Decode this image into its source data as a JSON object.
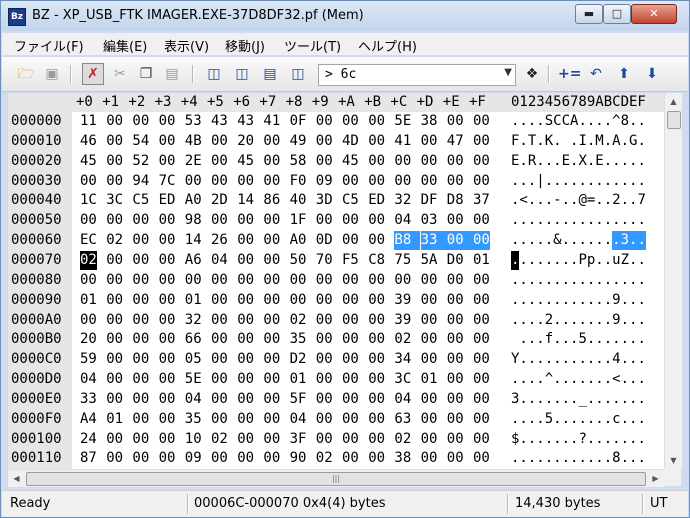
{
  "window": {
    "title": "BZ - XP_USB_FTK IMAGER.EXE-37D8DF32.pf (Mem)",
    "app_icon": "Bz"
  },
  "menu": [
    "ファイル(F)",
    "編集(E)",
    "表示(V)",
    "移動(J)",
    "ツール(T)",
    "ヘルプ(H)"
  ],
  "toolbar": {
    "address_value": "> 6c",
    "icons": [
      "open-folder-icon",
      "save-icon",
      "mark-icon",
      "cut-icon",
      "copy-icon",
      "paste-icon",
      "view-single-icon",
      "view-split-vertical-icon",
      "view-split-horizontal-icon",
      "view-compare-icon",
      "find-icon",
      "jump-icon",
      "back-icon",
      "up-icon",
      "down-icon"
    ]
  },
  "hex": {
    "header_offsets": [
      "+0",
      "+1",
      "+2",
      "+3",
      "+4",
      "+5",
      "+6",
      "+7",
      "+8",
      "+9",
      "+A",
      "+B",
      "+C",
      "+D",
      "+E",
      "+F"
    ],
    "header_ascii": "0123456789ABCDEF",
    "rows": [
      {
        "addr": "000000",
        "bytes": [
          "11",
          "00",
          "00",
          "00",
          "53",
          "43",
          "43",
          "41",
          "0F",
          "00",
          "00",
          "00",
          "5E",
          "38",
          "00",
          "00"
        ],
        "ascii": "....SCCA....^8.."
      },
      {
        "addr": "000010",
        "bytes": [
          "46",
          "00",
          "54",
          "00",
          "4B",
          "00",
          "20",
          "00",
          "49",
          "00",
          "4D",
          "00",
          "41",
          "00",
          "47",
          "00"
        ],
        "ascii": "F.T.K. .I.M.A.G."
      },
      {
        "addr": "000020",
        "bytes": [
          "45",
          "00",
          "52",
          "00",
          "2E",
          "00",
          "45",
          "00",
          "58",
          "00",
          "45",
          "00",
          "00",
          "00",
          "00",
          "00"
        ],
        "ascii": "E.R...E.X.E....."
      },
      {
        "addr": "000030",
        "bytes": [
          "00",
          "00",
          "94",
          "7C",
          "00",
          "00",
          "00",
          "00",
          "F0",
          "09",
          "00",
          "00",
          "00",
          "00",
          "00",
          "00"
        ],
        "ascii": "...|............"
      },
      {
        "addr": "000040",
        "bytes": [
          "1C",
          "3C",
          "C5",
          "ED",
          "A0",
          "2D",
          "14",
          "86",
          "40",
          "3D",
          "C5",
          "ED",
          "32",
          "DF",
          "D8",
          "37"
        ],
        "ascii": ".<...-..@=..2..7"
      },
      {
        "addr": "000050",
        "bytes": [
          "00",
          "00",
          "00",
          "00",
          "98",
          "00",
          "00",
          "00",
          "1F",
          "00",
          "00",
          "00",
          "04",
          "03",
          "00",
          "00"
        ],
        "ascii": "................"
      },
      {
        "addr": "000060",
        "bytes": [
          "EC",
          "02",
          "00",
          "00",
          "14",
          "26",
          "00",
          "00",
          "A0",
          "0D",
          "00",
          "00",
          "B8",
          "33",
          "00",
          "00"
        ],
        "ascii": ".....&.......3.."
      },
      {
        "addr": "000070",
        "bytes": [
          "02",
          "00",
          "00",
          "00",
          "A6",
          "04",
          "00",
          "00",
          "50",
          "70",
          "F5",
          "C8",
          "75",
          "5A",
          "D0",
          "01"
        ],
        "ascii": "........Pp..uZ.."
      },
      {
        "addr": "000080",
        "bytes": [
          "00",
          "00",
          "00",
          "00",
          "00",
          "00",
          "00",
          "00",
          "00",
          "00",
          "00",
          "00",
          "00",
          "00",
          "00",
          "00"
        ],
        "ascii": "................"
      },
      {
        "addr": "000090",
        "bytes": [
          "01",
          "00",
          "00",
          "00",
          "01",
          "00",
          "00",
          "00",
          "00",
          "00",
          "00",
          "00",
          "39",
          "00",
          "00",
          "00"
        ],
        "ascii": "............9..."
      },
      {
        "addr": "0000A0",
        "bytes": [
          "00",
          "00",
          "00",
          "00",
          "32",
          "00",
          "00",
          "00",
          "02",
          "00",
          "00",
          "00",
          "39",
          "00",
          "00",
          "00"
        ],
        "ascii": "....2.......9..."
      },
      {
        "addr": "0000B0",
        "bytes": [
          "20",
          "00",
          "00",
          "00",
          "66",
          "00",
          "00",
          "00",
          "35",
          "00",
          "00",
          "00",
          "02",
          "00",
          "00",
          "00"
        ],
        "ascii": " ...f...5......."
      },
      {
        "addr": "0000C0",
        "bytes": [
          "59",
          "00",
          "00",
          "00",
          "05",
          "00",
          "00",
          "00",
          "D2",
          "00",
          "00",
          "00",
          "34",
          "00",
          "00",
          "00"
        ],
        "ascii": "Y...........4..."
      },
      {
        "addr": "0000D0",
        "bytes": [
          "04",
          "00",
          "00",
          "00",
          "5E",
          "00",
          "00",
          "00",
          "01",
          "00",
          "00",
          "00",
          "3C",
          "01",
          "00",
          "00"
        ],
        "ascii": "....^.......<..."
      },
      {
        "addr": "0000E0",
        "bytes": [
          "33",
          "00",
          "00",
          "00",
          "04",
          "00",
          "00",
          "00",
          "5F",
          "00",
          "00",
          "00",
          "04",
          "00",
          "00",
          "00"
        ],
        "ascii": "3......._......."
      },
      {
        "addr": "0000F0",
        "bytes": [
          "A4",
          "01",
          "00",
          "00",
          "35",
          "00",
          "00",
          "00",
          "04",
          "00",
          "00",
          "00",
          "63",
          "00",
          "00",
          "00"
        ],
        "ascii": "....5.......c..."
      },
      {
        "addr": "000100",
        "bytes": [
          "24",
          "00",
          "00",
          "00",
          "10",
          "02",
          "00",
          "00",
          "3F",
          "00",
          "00",
          "00",
          "02",
          "00",
          "00",
          "00"
        ],
        "ascii": "$.......?......."
      },
      {
        "addr": "000110",
        "bytes": [
          "87",
          "00",
          "00",
          "00",
          "09",
          "00",
          "00",
          "00",
          "90",
          "02",
          "00",
          "00",
          "38",
          "00",
          "00",
          "00"
        ],
        "ascii": "............8..."
      }
    ]
  },
  "status": {
    "left": "Ready",
    "selection": "00006C-000070 0x4(4) bytes",
    "size": "14,430 bytes",
    "encoding": "UT"
  }
}
